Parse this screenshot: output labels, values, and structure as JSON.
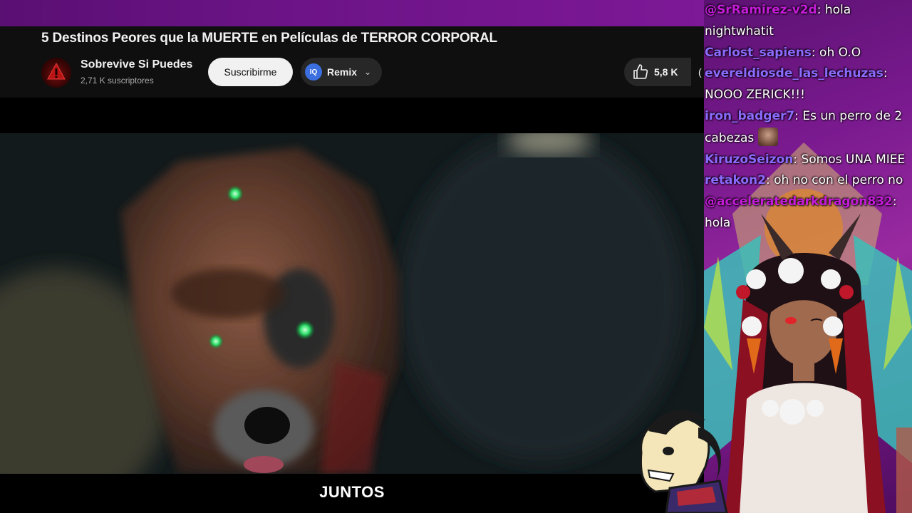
{
  "video": {
    "title": "5 Destinos Peores que la MUERTE en Películas de TERROR CORPORAL",
    "caption": "JUNTOS"
  },
  "channel": {
    "name": "Sobrevive Si Puedes",
    "subscribers": "2,71 K suscriptores"
  },
  "actions": {
    "subscribe_label": "Suscribirme",
    "remix_label": "Remix",
    "like_count": "5,8 K",
    "partial_label": "("
  },
  "icons": {
    "like": "thumbs-up-icon",
    "remix": "remix-icon",
    "dropdown": "chevron-down-icon"
  },
  "chat": {
    "messages": [
      {
        "user": "@SrRamirez-v2d",
        "text": ": hola nightwhatit",
        "color": "#c51bd9"
      },
      {
        "user": "Carlost_sapiens",
        "text": ": oh O.O",
        "color": "#8c6bff"
      },
      {
        "user": "evereldiosde_las_lechuzas",
        "text": ": NOOO ZERICK!!!",
        "color": "#8c6bff"
      },
      {
        "user": "iron_badger7",
        "text": ": Es un perro de 2 cabezas",
        "color": "#8c6bff",
        "emote": true
      },
      {
        "user": "KiruzoSeizon",
        "text": ": Somos UNA MIEE",
        "color": "#8c6bff"
      },
      {
        "user": "retakon2",
        "text": ": oh no con el perro no",
        "color": "#8c6bff"
      },
      {
        "user": "@acceleratedarkdragon832",
        "text": ": hola",
        "color": "#c51bd9"
      }
    ]
  },
  "colors": {
    "accent_purple": "#6c1487",
    "subscribe_bg": "#f1f1f1",
    "remix_blue": "#3b6fe0",
    "chat_user_purple": "#8c6bff",
    "chat_mention_magenta": "#c51bd9"
  }
}
